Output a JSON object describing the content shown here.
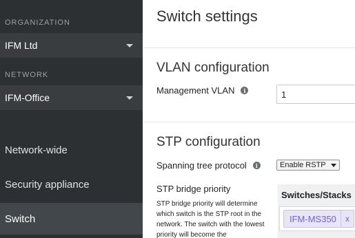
{
  "sidebar": {
    "organization": {
      "section_label": "ORGANIZATION",
      "selected": "IFM Ltd"
    },
    "network": {
      "section_label": "NETWORK",
      "selected": "IFM-Office"
    },
    "items": [
      {
        "label": "Network-wide",
        "active": false
      },
      {
        "label": "Security appliance",
        "active": false
      },
      {
        "label": "Switch",
        "active": true
      }
    ]
  },
  "main": {
    "page_title": "Switch settings",
    "vlan": {
      "section_title": "VLAN configuration",
      "management_vlan_label": "Management VLAN",
      "management_vlan_value": "1"
    },
    "stp": {
      "section_title": "STP configuration",
      "spanning_tree_label": "Spanning tree protocol",
      "spanning_tree_value": "Enable RSTP",
      "bridge_priority_label": "STP bridge priority",
      "bridge_priority_desc": "STP bridge priority will determine which switch is the STP root in the network. The switch with the lowest priority will become the",
      "switches_header": "Switches/Stacks",
      "switch_tag": "IFM-MS350",
      "switch_tag_remove": "x"
    }
  },
  "colors": {
    "sidebar_bg": "#2d3033",
    "sidebar_active_bg": "#42474b",
    "tag_text": "#6f62c9"
  }
}
